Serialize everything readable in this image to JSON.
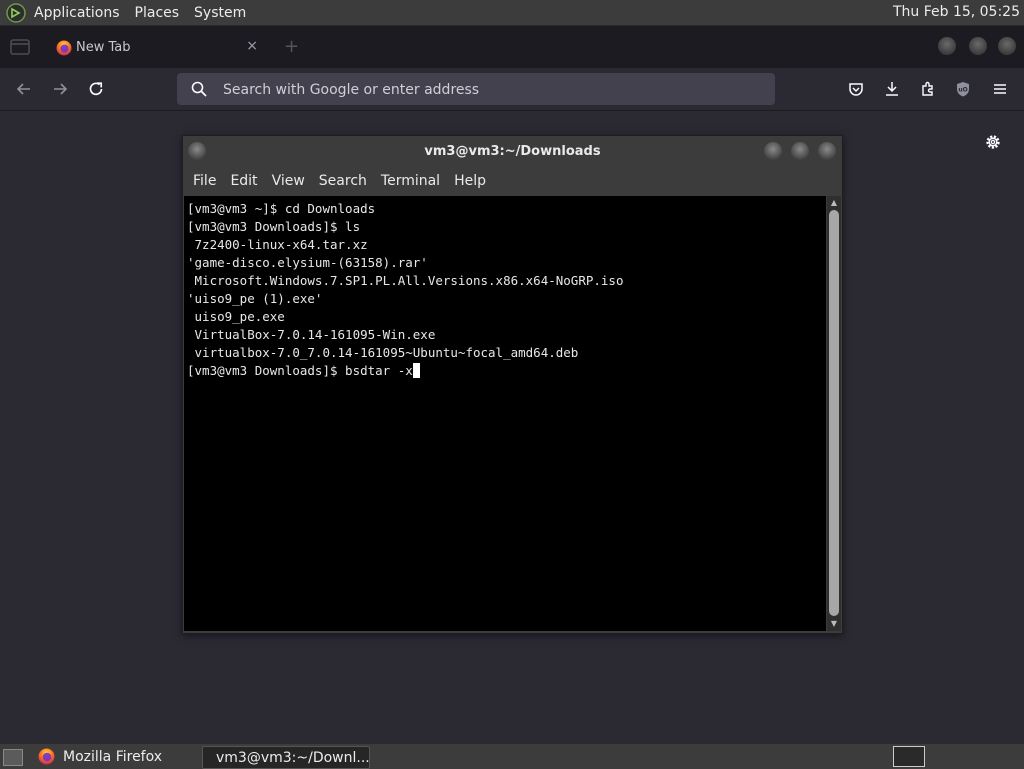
{
  "top_panel": {
    "menus": [
      "Applications",
      "Places",
      "System"
    ],
    "clock": "Thu Feb 15, 05:25"
  },
  "browser": {
    "tab": {
      "title": "New Tab",
      "close": "×"
    },
    "new_tab": "+",
    "url_bar": {
      "placeholder": "Search with Google or enter address"
    }
  },
  "terminal": {
    "title": "vm3@vm3:~/Downloads",
    "menus": [
      "File",
      "Edit",
      "View",
      "Search",
      "Terminal",
      "Help"
    ],
    "lines": [
      "[vm3@vm3 ~]$ cd Downloads",
      "[vm3@vm3 Downloads]$ ls",
      " 7z2400-linux-x64.tar.xz",
      "'game-disco.elysium-(63158).rar'",
      " Microsoft.Windows.7.SP1.PL.All.Versions.x86.x64-NoGRP.iso",
      "'uiso9_pe (1).exe'",
      " uiso9_pe.exe",
      " VirtualBox-7.0.14-161095-Win.exe",
      " virtualbox-7.0_7.0.14-161095~Ubuntu~focal_amd64.deb"
    ],
    "prompt_line": "[vm3@vm3 Downloads]$ bsdtar -x"
  },
  "taskbar": {
    "tasks": [
      {
        "label": "Mozilla Firefox",
        "icon": "firefox-icon"
      },
      {
        "label": "vm3@vm3:~/Downl...",
        "icon": "terminal-icon"
      }
    ]
  },
  "colors": {
    "panel": "#3c3c3c",
    "browser_bg": "#2b2a33",
    "urlbar": "#42414d",
    "terminal_bg": "#000000"
  }
}
